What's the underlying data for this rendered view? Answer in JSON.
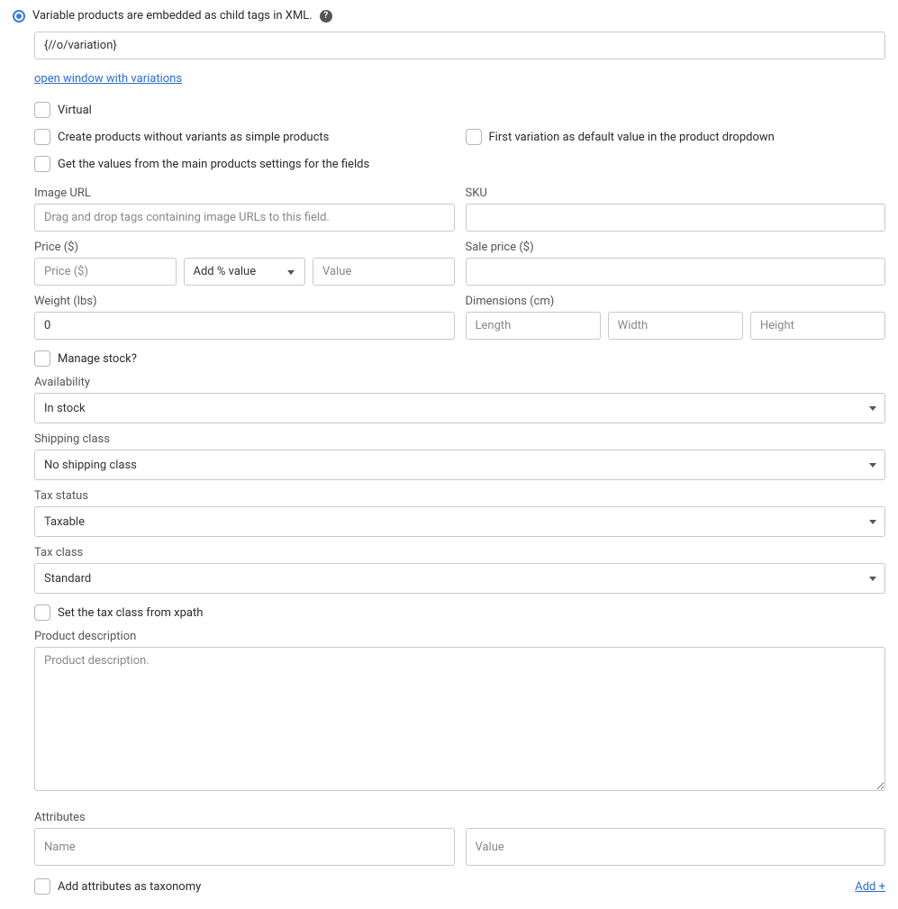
{
  "header": {
    "radio_label": "Variable products are embedded as child tags in XML.",
    "xpath_value": "{//o/variation}",
    "open_variations_link": "open window with variations"
  },
  "checkboxes": {
    "virtual": "Virtual",
    "create_simple": "Create products without variants as simple products",
    "first_variation_default": "First variation as default value in the product dropdown",
    "get_from_main": "Get the values from the main products settings for the fields",
    "manage_stock": "Manage stock?",
    "tax_from_xpath": "Set the tax class from xpath",
    "attr_as_taxonomy": "Add attributes as taxonomy"
  },
  "labels": {
    "image_url": "Image URL",
    "sku": "SKU",
    "price": "Price ($)",
    "sale_price": "Sale price ($)",
    "weight": "Weight (lbs)",
    "dimensions": "Dimensions (cm)",
    "availability": "Availability",
    "shipping_class": "Shipping class",
    "tax_status": "Tax status",
    "tax_class": "Tax class",
    "product_description": "Product description",
    "attributes": "Attributes"
  },
  "placeholders": {
    "image_url": "Drag and drop tags containing image URLs to this field.",
    "price": "Price ($)",
    "price_value": "Value",
    "length": "Length",
    "width": "Width",
    "height": "Height",
    "product_description": "Product description.",
    "attr_name": "Name",
    "attr_value": "Value"
  },
  "values": {
    "weight": "0"
  },
  "selects": {
    "price_mode": "Add % value",
    "availability": "In stock",
    "shipping_class": "No shipping class",
    "tax_status": "Taxable",
    "tax_class": "Standard"
  },
  "add_link": "Add +"
}
